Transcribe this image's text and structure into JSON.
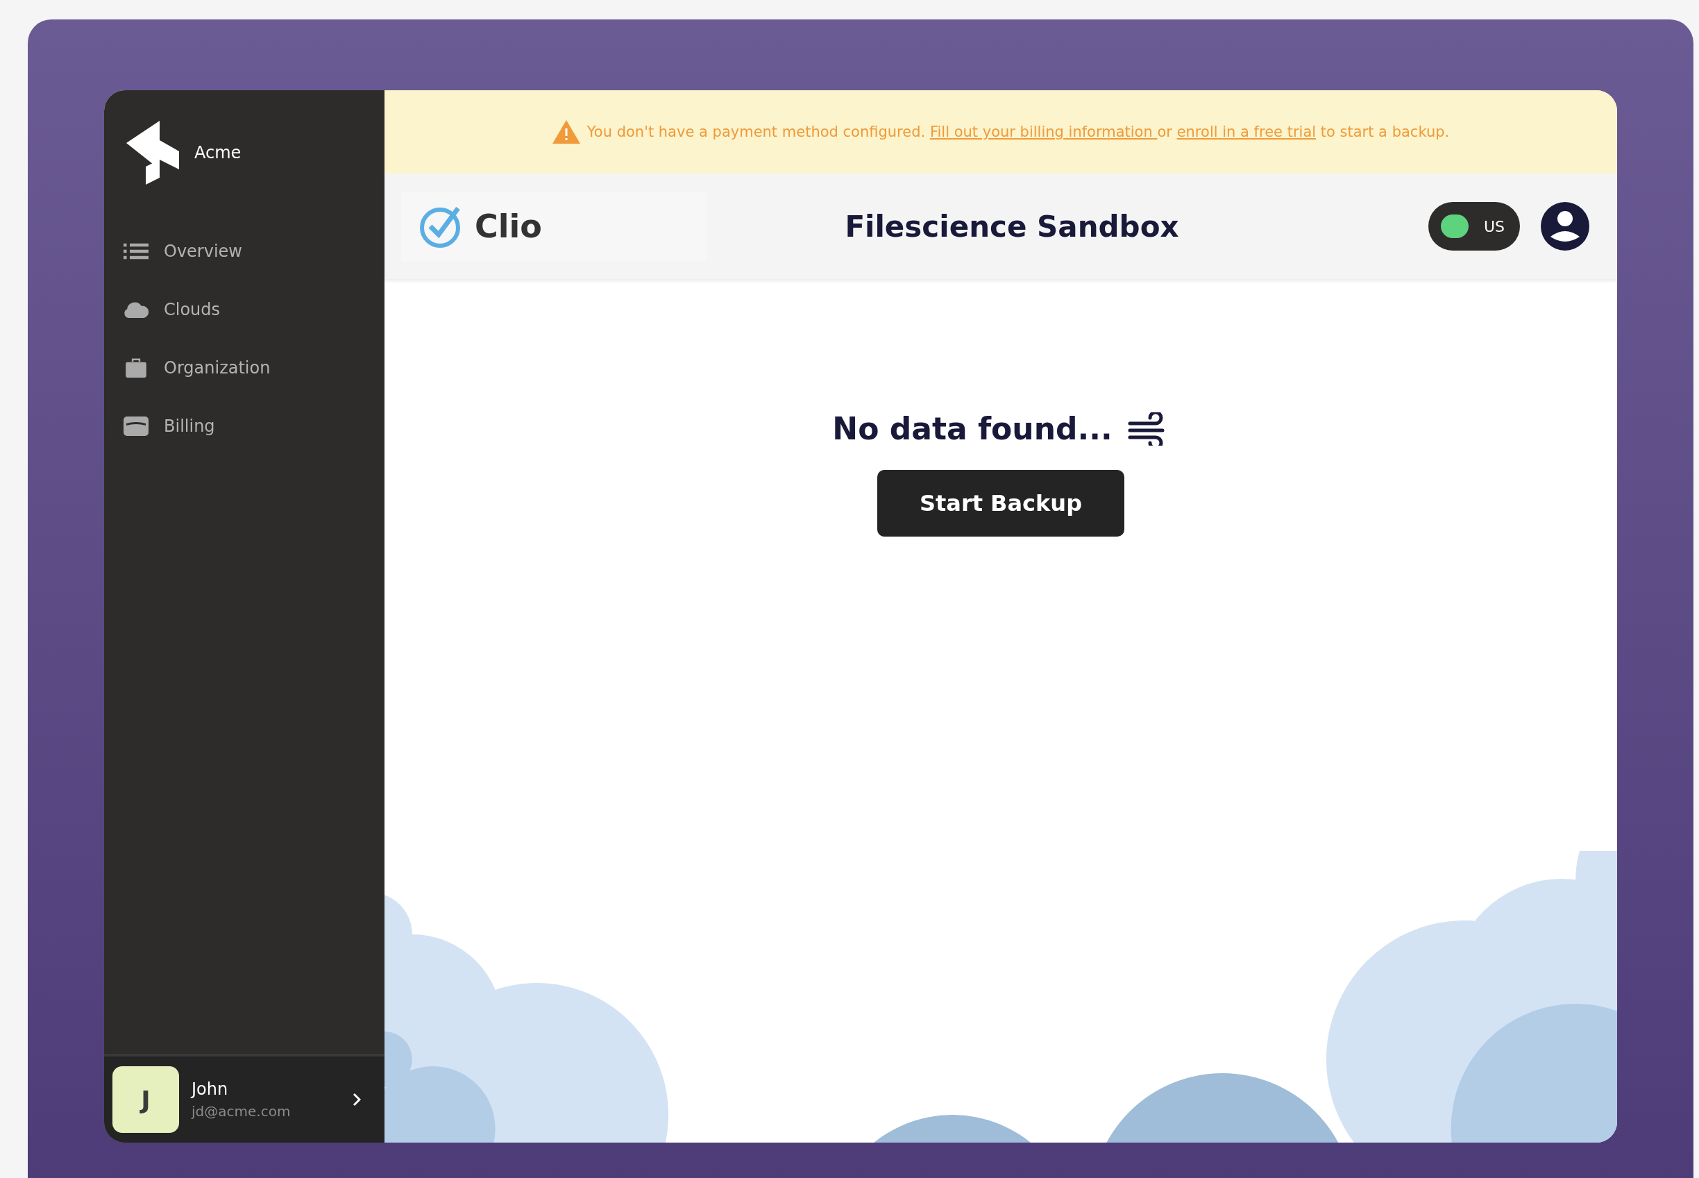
{
  "sidebar": {
    "brand": "Acme",
    "items": [
      {
        "label": "Overview"
      },
      {
        "label": "Clouds"
      },
      {
        "label": "Organization"
      },
      {
        "label": "Billing"
      }
    ],
    "user": {
      "initial": "J",
      "name": "John",
      "email": "jd@acme.com"
    }
  },
  "banner": {
    "parts": [
      {
        "kind": "text",
        "text": "You don't have a payment method configured. "
      },
      {
        "kind": "link",
        "text": "Fill out your billing information "
      },
      {
        "kind": "text",
        "text": "or "
      },
      {
        "kind": "link",
        "text": "enroll in a free trial"
      },
      {
        "kind": "text",
        "text": " to start a backup."
      }
    ]
  },
  "header": {
    "app_name": "Clio",
    "title": "Filescience Sandbox",
    "region": {
      "label": "US",
      "on": true
    }
  },
  "empty_state": {
    "message": "No data found...",
    "button": "Start Backup"
  }
}
